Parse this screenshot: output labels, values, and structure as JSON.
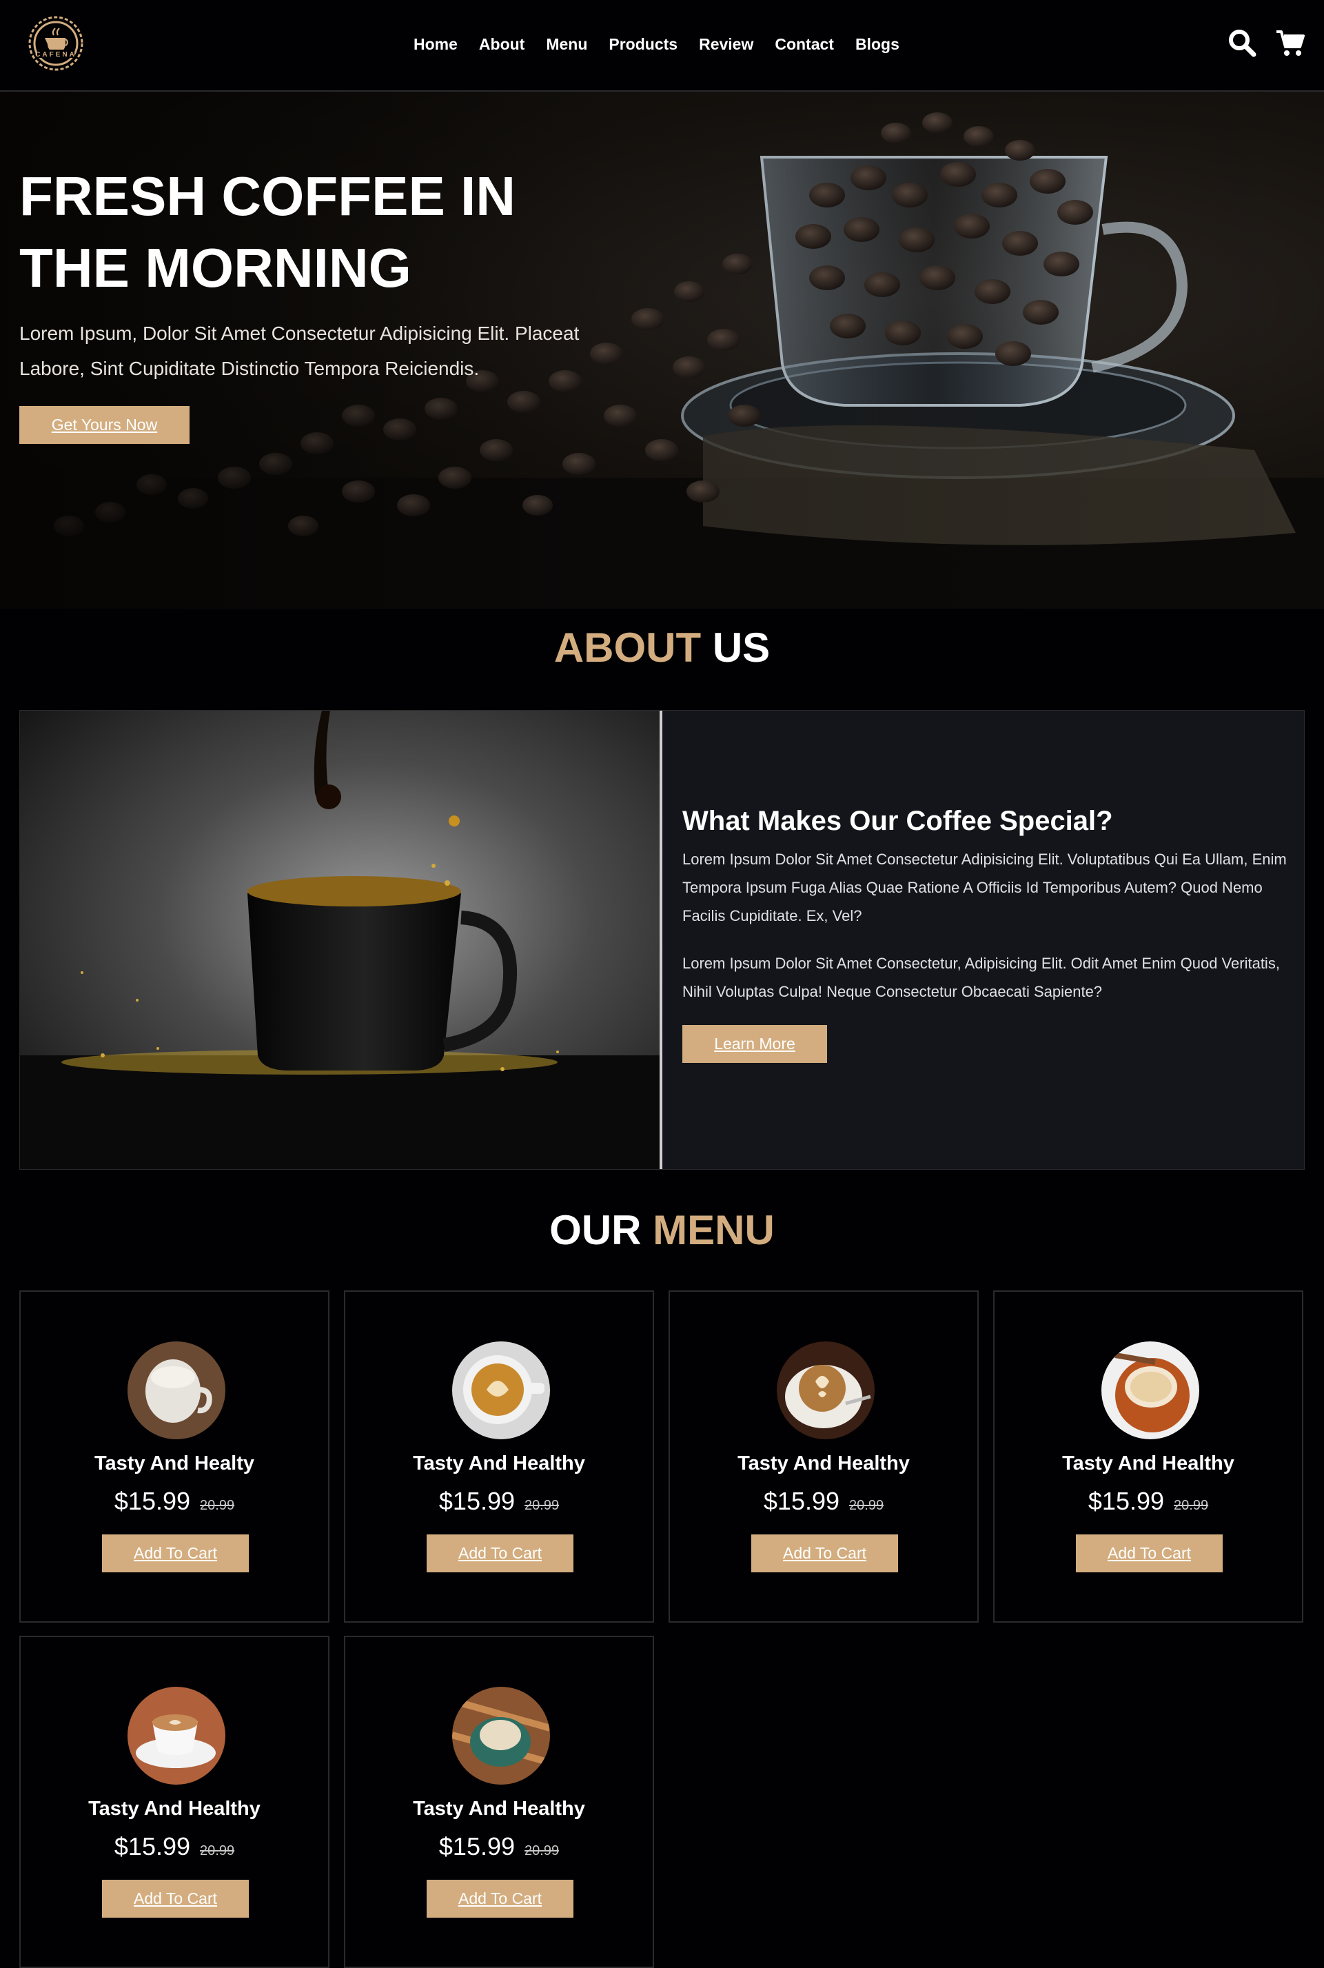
{
  "brand": {
    "logo_text": "CAFENA",
    "accent_color": "#d3ad7f",
    "background_color": "#010103"
  },
  "nav": {
    "items": [
      {
        "label": "Home"
      },
      {
        "label": "About"
      },
      {
        "label": "Menu"
      },
      {
        "label": "Products"
      },
      {
        "label": "Review"
      },
      {
        "label": "Contact"
      },
      {
        "label": "Blogs"
      }
    ],
    "icons": [
      "search-icon",
      "cart-icon"
    ]
  },
  "hero": {
    "title_line1": "FRESH COFFEE IN",
    "title_line2": "THE MORNING",
    "description_line1": "Lorem Ipsum, Dolor Sit Amet Consectetur Adipisicing Elit. Placeat",
    "description_line2": "Labore, Sint Cupiditate Distinctio Tempora Reiciendis.",
    "button_label": "Get Yours Now"
  },
  "about": {
    "heading_accent": "ABOUT",
    "heading_rest": "US",
    "title": "What Makes Our Coffee Special?",
    "paragraph1": "Lorem Ipsum Dolor Sit Amet Consectetur Adipisicing Elit. Voluptatibus Qui Ea Ullam, Enim Tempora Ipsum Fuga Alias Quae Ratione A Officiis Id Temporibus Autem? Quod Nemo Facilis Cupiditate. Ex, Vel?",
    "paragraph2": "Lorem Ipsum Dolor Sit Amet Consectetur, Adipisicing Elit. Odit Amet Enim Quod Veritatis, Nihil Voluptas Culpa! Neque Consectetur Obcaecati Sapiente?",
    "button_label": "Learn More"
  },
  "menu": {
    "heading_plain": "OUR",
    "heading_accent": "MENU",
    "items": [
      {
        "name": "Tasty And Healty",
        "price": "$15.99",
        "old_price": "20.99",
        "button_label": "Add To Cart"
      },
      {
        "name": "Tasty And Healthy",
        "price": "$15.99",
        "old_price": "20.99",
        "button_label": "Add To Cart"
      },
      {
        "name": "Tasty And Healthy",
        "price": "$15.99",
        "old_price": "20.99",
        "button_label": "Add To Cart"
      },
      {
        "name": "Tasty And Healthy",
        "price": "$15.99",
        "old_price": "20.99",
        "button_label": "Add To Cart"
      },
      {
        "name": "Tasty And Healthy",
        "price": "$15.99",
        "old_price": "20.99",
        "button_label": "Add To Cart"
      },
      {
        "name": "Tasty And Healthy",
        "price": "$15.99",
        "old_price": "20.99",
        "button_label": "Add To Cart"
      }
    ]
  }
}
